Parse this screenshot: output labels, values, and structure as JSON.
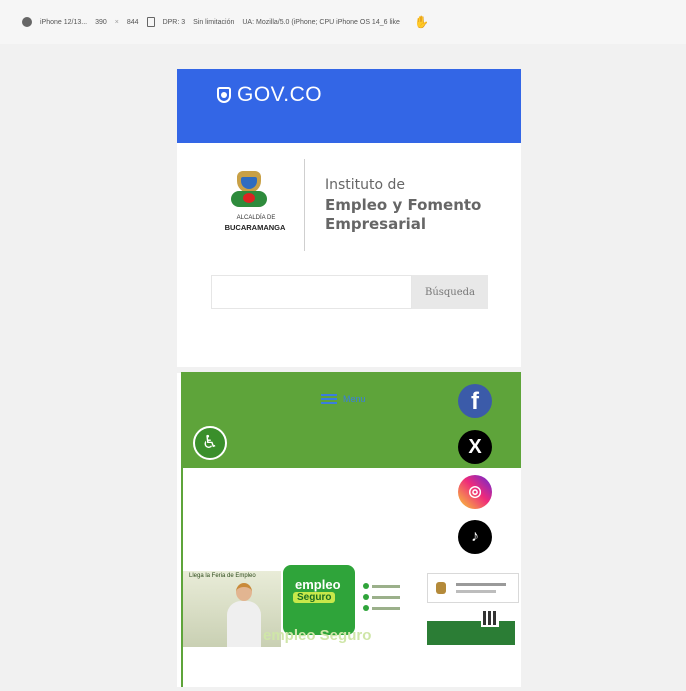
{
  "devtools": {
    "device": "iPhone 12/13...",
    "width": "390",
    "times": "×",
    "height": "844",
    "dpr": "DPR: 3",
    "throttle": "Sin limitación",
    "ua": "UA: Mozilla/5.0 (iPhone; CPU iPhone OS 14_6 like"
  },
  "header": {
    "logo_text": "GOV.CO",
    "color": "#3366e6"
  },
  "brand": {
    "alcaldia_small": "ALCALDÍA DE",
    "alcaldia_big": "BUCARAMANGA",
    "institute_line1": "Instituto de",
    "institute_line2": "Empleo y Fomento",
    "institute_line3": "Empresarial"
  },
  "search": {
    "value": "",
    "button_label": "Búsqueda"
  },
  "nav": {
    "menu_label": "Menu",
    "green": "#5ea43a"
  },
  "social": [
    {
      "icon": "facebook-icon",
      "glyph": "f"
    },
    {
      "icon": "x-twitter-icon",
      "glyph": "X"
    },
    {
      "icon": "instagram-icon",
      "glyph": "◎"
    },
    {
      "icon": "tiktok-icon",
      "glyph": "♪"
    }
  ],
  "banner": {
    "kicker": "Llega la Feria de Empleo",
    "logo_line1": "empleo",
    "logo_line2": "Seguro",
    "watermark": "empleo Seguro"
  },
  "accessibility": {
    "icon": "accessibility-icon",
    "glyph": "♿"
  }
}
